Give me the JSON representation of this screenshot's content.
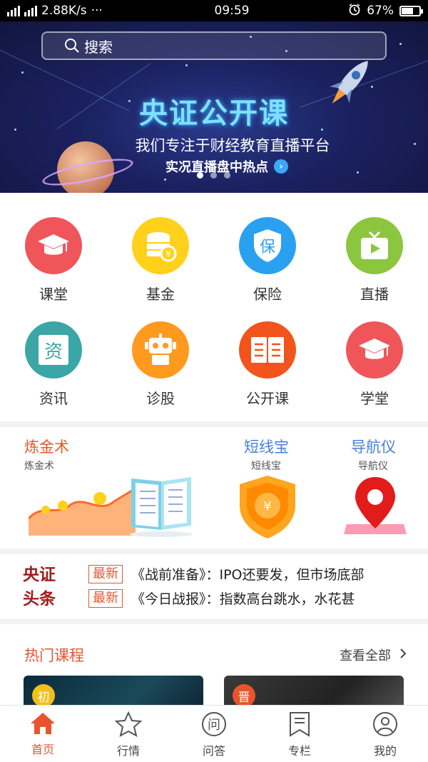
{
  "status_bar": {
    "network": "2.88K/s",
    "more": "···",
    "time": "09:59",
    "battery": "67%",
    "battery_level": 0.67
  },
  "banner": {
    "search_placeholder": "搜索",
    "brand_title": "央证公开课",
    "tagline": "我们专注于财经教育直播平台",
    "subline": "实况直播盘中热点",
    "slide_count": 3,
    "active_slide": 0
  },
  "categories": [
    {
      "label": "课堂",
      "icon": "graduation-cap-icon",
      "color": "#f0555a"
    },
    {
      "label": "基金",
      "icon": "coin-stack-icon",
      "color": "#ffd11a"
    },
    {
      "label": "保险",
      "icon": "shield-icon",
      "color": "#2aa1f0",
      "glyph": "保"
    },
    {
      "label": "直播",
      "icon": "tv-play-icon",
      "color": "#8cc63f"
    },
    {
      "label": "资讯",
      "icon": "news-icon",
      "color": "#3aa6a6",
      "glyph": "资"
    },
    {
      "label": "诊股",
      "icon": "robot-icon",
      "color": "#ff9a1f"
    },
    {
      "label": "公开课",
      "icon": "open-book-icon",
      "color": "#f2541c"
    },
    {
      "label": "学堂",
      "icon": "graduation-cap-icon",
      "color": "#f0555a"
    }
  ],
  "features": [
    {
      "title": "炼金术",
      "subtitle": "炼金术",
      "color": "#e8552b"
    },
    {
      "title": "短线宝",
      "subtitle": "短线宝",
      "color": "#4a7fd4"
    },
    {
      "title": "导航仪",
      "subtitle": "导航仪",
      "color": "#4a7fd4"
    }
  ],
  "news": {
    "logo_line1": "央证",
    "logo_line2": "头条",
    "items": [
      {
        "tag": "最新",
        "text": "《战前准备》：IPO还要发，但市场底部"
      },
      {
        "tag": "最新",
        "text": "《今日战报》：指数高台跳水，水花甚"
      }
    ]
  },
  "hot_courses": {
    "title": "热门课程",
    "view_all": "查看全部",
    "cards": [
      {
        "level": "初",
        "level_color": "#f2c01c"
      },
      {
        "level": "晋",
        "level_color": "#e8552b"
      }
    ]
  },
  "tab_bar": {
    "active": 0,
    "tabs": [
      {
        "label": "首页",
        "icon": "home-icon"
      },
      {
        "label": "行情",
        "icon": "star-icon"
      },
      {
        "label": "问答",
        "icon": "qa-icon"
      },
      {
        "label": "专栏",
        "icon": "bookmark-column-icon"
      },
      {
        "label": "我的",
        "icon": "user-icon"
      }
    ]
  },
  "colors": {
    "accent": "#e8552b",
    "link_blue": "#4a7fd4"
  }
}
